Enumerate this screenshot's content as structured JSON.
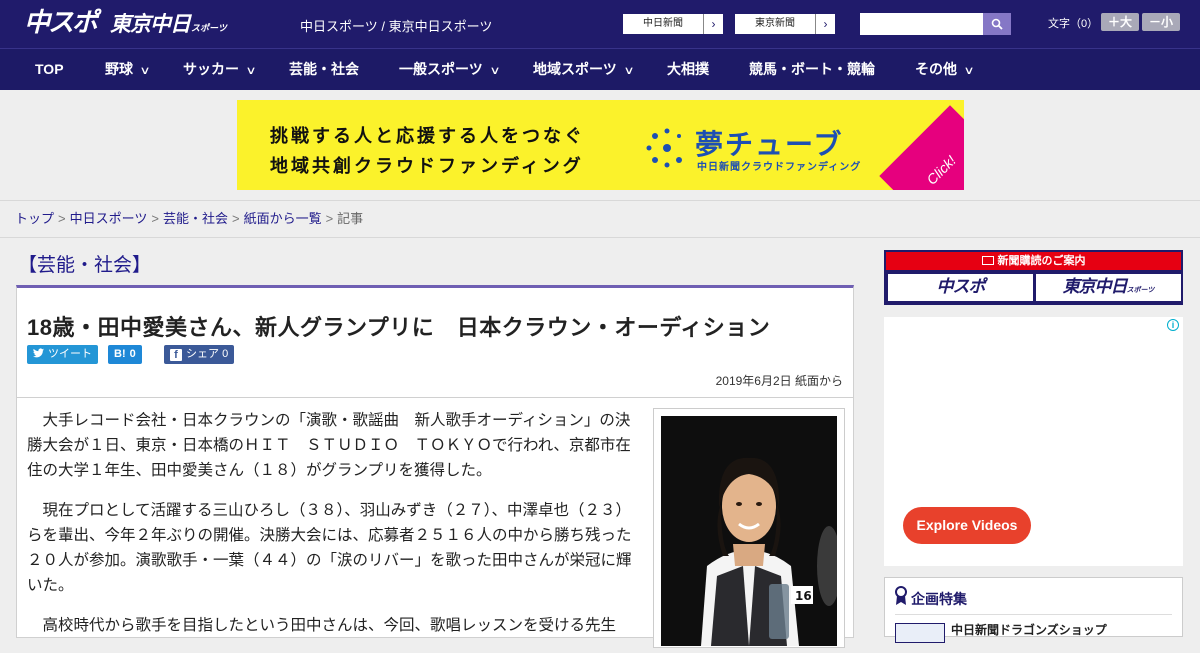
{
  "header": {
    "logo_chuspo": "中スポ",
    "logo_tokyo": "東京中日",
    "logo_tokyo_small": "スポーツ",
    "site_names": "中日スポーツ / 東京中日スポーツ",
    "links": [
      "中日新聞",
      "東京新聞"
    ],
    "search_placeholder": "",
    "fontsize_label": "文字（0）",
    "font_larger": "＋大",
    "font_smaller": "－小"
  },
  "nav": {
    "items": [
      {
        "label": "TOP",
        "has_dropdown": false
      },
      {
        "label": "野球",
        "has_dropdown": true
      },
      {
        "label": "サッカー",
        "has_dropdown": true
      },
      {
        "label": "芸能・社会",
        "has_dropdown": false
      },
      {
        "label": "一般スポーツ",
        "has_dropdown": true
      },
      {
        "label": "地域スポーツ",
        "has_dropdown": true
      },
      {
        "label": "大相撲",
        "has_dropdown": false
      },
      {
        "label": "競馬・ボート・競輪",
        "has_dropdown": false
      },
      {
        "label": "その他",
        "has_dropdown": true
      }
    ]
  },
  "banner": {
    "line1": "挑戦する人と応援する人をつなぐ",
    "line2": "地域共創クラウドファンディング",
    "brand": "夢チューブ",
    "brand_sub": "中日新聞クラウドファンディング",
    "click": "Click!"
  },
  "breadcrumb": {
    "items": [
      "トップ",
      "中日スポーツ",
      "芸能・社会",
      "紙面から一覧"
    ],
    "current": "記事"
  },
  "article": {
    "category": "【芸能・社会】",
    "title": "18歳・田中愛美さん、新人グランプリに　日本クラウン・オーディション",
    "share": {
      "tweet": "ツイート",
      "hatena_count": "0",
      "facebook_label": "シェア",
      "facebook_count": "0"
    },
    "date": "2019年6月2日 紙面から",
    "paragraphs": [
      "大手レコード会社・日本クラウンの「演歌・歌謡曲　新人歌手オーディション」の決勝大会が１日、東京・日本橋のＨＩＴ　ＳＴＵＤＩＯ　ＴＯＫＹＯで行われ、京都市在住の大学１年生、田中愛美さん（１８）がグランプリを獲得した。",
      "現在プロとして活躍する三山ひろし（３８）、羽山みずき（２７）、中澤卓也（２３）らを輩出、今年２年ぶりの開催。決勝大会には、応募者２５１６人の中から勝ち残った２０人が参加。演歌歌手・一葉（４４）の「涙のリバー」を歌った田中さんが栄冠に輝いた。",
      "高校時代から歌手を目指したという田中さんは、今回、歌唱レッスンを受ける先生"
    ],
    "photo_badge": "16"
  },
  "sidebar": {
    "subscription_heading": "新聞購読のご案内",
    "sub_chuspo": "中スポ",
    "sub_tokyo": "東京中日",
    "sub_tokyo_small": "スポーツ",
    "ad_button": "Explore Videos",
    "feature_title": "企画特集",
    "feature_item": "中日新聞ドラゴンズショップ"
  },
  "colors": {
    "header_bg": "#201b6b",
    "nav_bg": "#1d1a66",
    "banner_bg": "#fbf22b",
    "accent_red": "#e60012",
    "link": "#201b8b",
    "explore_btn": "#e8412c"
  }
}
